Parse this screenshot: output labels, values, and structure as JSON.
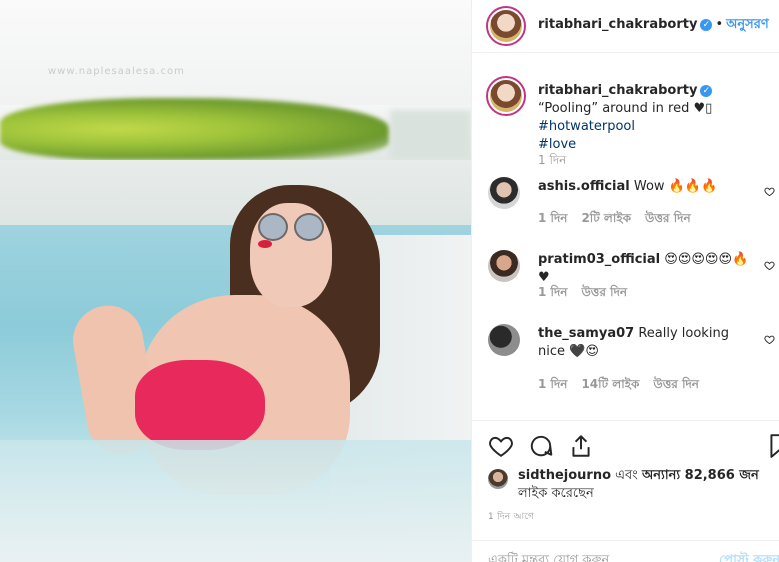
{
  "post": {
    "username": "ritabhari_chakraborty",
    "follow_label": "অনুসরণ",
    "separator": "•"
  },
  "caption": {
    "username": "ritabhari_chakraborty",
    "text": "“Pooling” around in red ♥︎▯ ",
    "tag1": "#hotwaterpool",
    "tag2": "#love",
    "age": "1 দিন"
  },
  "comments": [
    {
      "username": "ashis.official",
      "text": "Wow 🔥🔥🔥",
      "age": "1 দিন",
      "likes": "2টি লাইক",
      "reply": "উত্তর দিন"
    },
    {
      "username": "pratim03_official",
      "text": "😍😍😍😍😍🔥♥",
      "age": "1 দিন",
      "reply": "উত্তর দিন"
    },
    {
      "username": "the_samya07",
      "text": "Really looking nice 🖤😍",
      "age": "1 দিন",
      "likes": "14টি লাইক",
      "reply": "উত্তর দিন"
    }
  ],
  "likes_line": {
    "user": "sidthejourno",
    "middle": " এবং ",
    "others": "অন্যান্য 82,866 জন",
    "suffix": "লাইক করেছেন"
  },
  "timestamp": "1 দিন আগে",
  "add_comment": {
    "placeholder": "একটি মন্তব্য যোগ করুন",
    "post_label": "পোস্ট করুন"
  },
  "photo": {
    "watermark": "www.naplesaalesa.com"
  },
  "colors": {
    "link": "#3897f0",
    "hashtag": "#003569",
    "muted": "#999999",
    "ring": "#c13584"
  },
  "icons": [
    "verified-badge-icon",
    "heart-icon",
    "comment-icon",
    "share-icon",
    "bookmark-icon",
    "comment-like-heart-icon"
  ]
}
